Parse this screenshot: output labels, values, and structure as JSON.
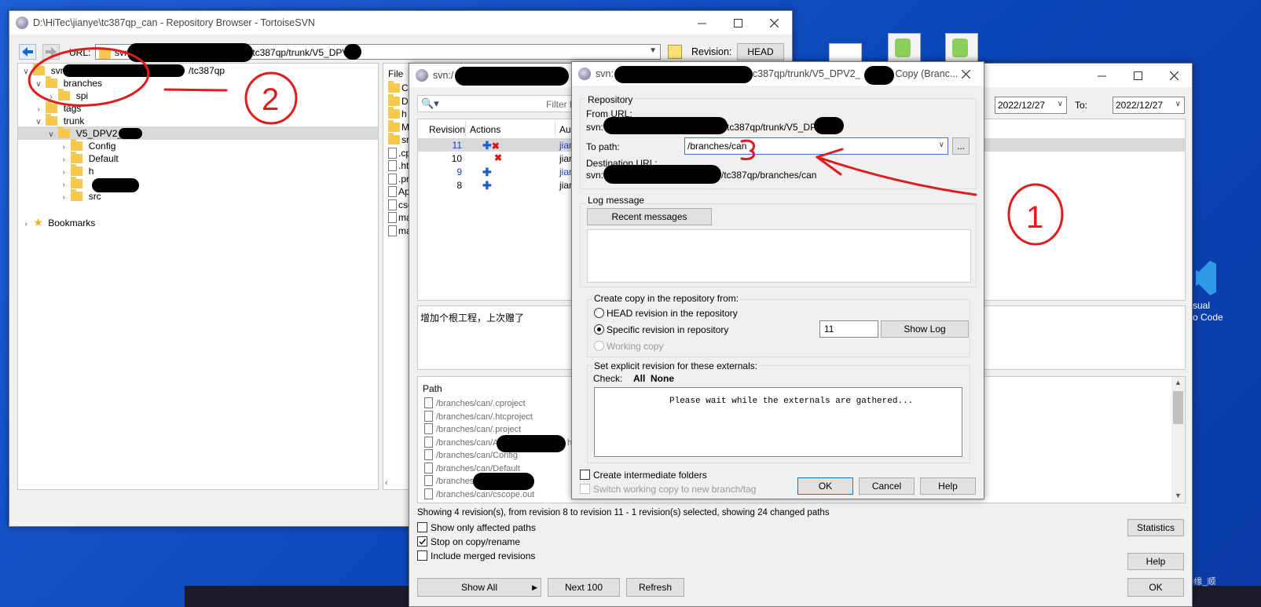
{
  "desktop": {
    "icon_label_right": "sual\no Code",
    "watermark": "CSDN @缘_顺"
  },
  "repo_browser": {
    "title": "D:\\HiTec\\jianye\\tc387qp_can - Repository Browser - TortoiseSVN",
    "url_label": "URL:",
    "url_prefix": "svn:",
    "url_suffix": "/tc387qp/trunk/V5_DPV2_",
    "revision_label": "Revision:",
    "revision_button": "HEAD",
    "tree": {
      "root_prefix": "svn:",
      "root_suffix": "/tc387qp",
      "branches": "branches",
      "spi": "spi",
      "tags": "tags",
      "trunk": "trunk",
      "v5": "V5_DPV2_",
      "config": "Config",
      "default": "Default",
      "h": "h",
      "src": "src",
      "bookmarks": "Bookmarks"
    },
    "file_header": "File",
    "files": [
      "Co",
      "De",
      "h",
      "Ma",
      "src",
      ".cp",
      ".ht",
      ".pr",
      "Ap",
      "csc",
      "ma",
      "ma"
    ]
  },
  "log_window": {
    "title_prefix": "svn:/",
    "filter_placeholder": "Filter b",
    "date_from": "2022/12/27",
    "to_label": "To:",
    "date_to": "2022/12/27",
    "columns": {
      "revision": "Revision",
      "actions": "Actions",
      "author": "Aut"
    },
    "rows": [
      {
        "rev": "11",
        "author": "jian"
      },
      {
        "rev": "10",
        "author": "jian"
      },
      {
        "rev": "9",
        "author": "jian"
      },
      {
        "rev": "8",
        "author": "jian"
      }
    ],
    "message": "增加个根工程，上次赠了",
    "path_header": "Path",
    "paths": [
      "/branches/can/.cproject",
      "/branches/can/.htcproject",
      "/branches/can/.project",
      "/branches/can/App_",
      "/branches/can/Config",
      "/branches/can/Default",
      "/branches/c",
      "/branches/can/cscope.out"
    ],
    "path_suffix_4": "h",
    "status": "Showing 4 revision(s), from revision 8 to revision 11 - 1 revision(s) selected, showing 24 changed paths",
    "options": [
      {
        "label": "Show only affected paths",
        "checked": false
      },
      {
        "label": "Stop on copy/rename",
        "checked": true
      },
      {
        "label": "Include merged revisions",
        "checked": false
      }
    ],
    "statistics_button": "Statistics",
    "help_button": "Help",
    "show_all_button": "Show All",
    "next_button": "Next 100",
    "refresh_button": "Refresh",
    "ok_button": "OK"
  },
  "copy_dialog": {
    "title_prefix": "svn:",
    "title_suffix": "/tc387qp/trunk/V5_DPV2_",
    "title_tail": "Copy (Branc...",
    "repository_group": "Repository",
    "from_url_label": "From URL:",
    "from_url_prefix": "svn:",
    "from_url_suffix": "tc387qp/trunk/V5_DPV2_",
    "to_path_label": "To path:",
    "to_path_value": "/branches/can",
    "browse_button": "...",
    "dest_url_label": "Destination URL:",
    "dest_url_prefix": "svn:",
    "dest_url_suffix": "/tc387qp/branches/can",
    "log_group": "Log message",
    "recent_button": "Recent messages",
    "create_copy_group": "Create copy in the repository from:",
    "opt_head": "HEAD revision in the repository",
    "opt_specific": "Specific revision in repository",
    "opt_working": "Working copy",
    "revision_value": "11",
    "show_log_button": "Show Log",
    "externals_group": "Set explicit revision for these externals:",
    "check_label": "Check:",
    "check_all": "All",
    "check_none": "None",
    "externals_wait": "Please wait while the externals are gathered...",
    "create_intermediate": "Create intermediate folders",
    "switch_wc": "Switch working copy to new branch/tag",
    "ok_button": "OK",
    "cancel_button": "Cancel",
    "help_button": "Help"
  },
  "annotations": {
    "circle_1": "1",
    "circle_2": "2",
    "accent_color": "#e01b1b"
  }
}
